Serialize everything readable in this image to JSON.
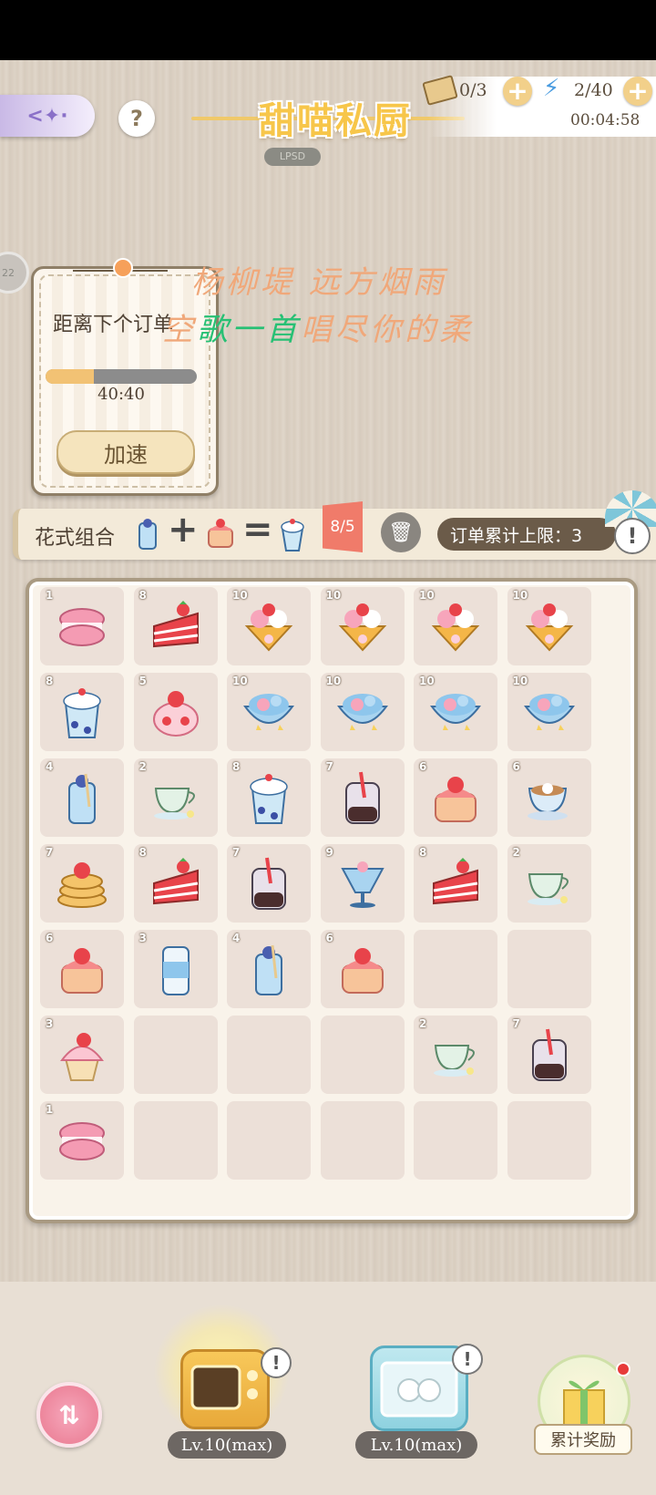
{
  "header": {
    "title": "甜喵私厨",
    "title_tag": "LPSD",
    "help_glyph": "?",
    "back_glyph": "<✦·",
    "tickets": "0/3",
    "energy": "2/40",
    "countdown": "00:04:58",
    "side_badge": "22"
  },
  "order_card": {
    "label": "距离下个订单",
    "progress_fraction": 0.32,
    "timer": "40:40",
    "speed_button": "加速"
  },
  "lyrics": {
    "line1": "杨柳堤 远方烟雨",
    "line2_prefix": "空",
    "line2_green": "歌一首",
    "line2_suffix": "唱尽你的柔"
  },
  "combo": {
    "label": "花式组合",
    "plus": "+",
    "equals": "=",
    "count": "8/5",
    "limit_label": "订单累计上限：3",
    "warn": "!"
  },
  "grid": {
    "rows": [
      [
        {
          "level": "1",
          "item": "macaron"
        },
        {
          "level": "8",
          "item": "cake-slice"
        },
        {
          "level": "10",
          "item": "waffle-sundae"
        },
        {
          "level": "10",
          "item": "waffle-sundae"
        },
        {
          "level": "10",
          "item": "waffle-sundae"
        },
        {
          "level": "10",
          "item": "waffle-sundae"
        }
      ],
      [
        {
          "level": "8",
          "item": "frappe"
        },
        {
          "level": "5",
          "item": "strawberry-mousse"
        },
        {
          "level": "10",
          "item": "jelly-bowl"
        },
        {
          "level": "10",
          "item": "jelly-bowl"
        },
        {
          "level": "10",
          "item": "jelly-bowl"
        },
        {
          "level": "10",
          "item": "jelly-bowl"
        }
      ],
      [
        {
          "level": "4",
          "item": "blueberry-soda"
        },
        {
          "level": "2",
          "item": "tea-cup"
        },
        {
          "level": "8",
          "item": "frappe"
        },
        {
          "level": "7",
          "item": "boba-jar"
        },
        {
          "level": "6",
          "item": "strawberry-cake"
        },
        {
          "level": "6",
          "item": "latte-art-cup"
        }
      ],
      [
        {
          "level": "7",
          "item": "pancake-stack"
        },
        {
          "level": "8",
          "item": "cake-slice"
        },
        {
          "level": "7",
          "item": "boba-jar"
        },
        {
          "level": "9",
          "item": "parfait-glass"
        },
        {
          "level": "8",
          "item": "cake-slice"
        },
        {
          "level": "2",
          "item": "tea-cup"
        }
      ],
      [
        {
          "level": "6",
          "item": "strawberry-cake"
        },
        {
          "level": "3",
          "item": "soda-can"
        },
        {
          "level": "4",
          "item": "blueberry-soda"
        },
        {
          "level": "6",
          "item": "strawberry-cake"
        },
        {
          "level": "",
          "item": ""
        },
        {
          "level": "",
          "item": ""
        }
      ],
      [
        {
          "level": "3",
          "item": "cupcake"
        },
        {
          "level": "",
          "item": ""
        },
        {
          "level": "",
          "item": ""
        },
        {
          "level": "",
          "item": ""
        },
        {
          "level": "2",
          "item": "tea-cup"
        },
        {
          "level": "7",
          "item": "boba-jar"
        }
      ],
      [
        {
          "level": "1",
          "item": "macaron"
        },
        {
          "level": "",
          "item": ""
        },
        {
          "level": "",
          "item": ""
        },
        {
          "level": "",
          "item": ""
        },
        {
          "level": "",
          "item": ""
        },
        {
          "level": "",
          "item": ""
        }
      ]
    ]
  },
  "bottom": {
    "oven_level": "Lv.10(max)",
    "dish_level": "Lv.10(max)",
    "reward_label": "累计奖励",
    "sort_glyph": "⇅",
    "oven_warn": "!",
    "dish_warn": "!"
  },
  "colors": {
    "accent": "#f2c274",
    "brand_title": "#f7c64a",
    "lyric": "#f0a87a",
    "lyric_green": "#27c074"
  }
}
